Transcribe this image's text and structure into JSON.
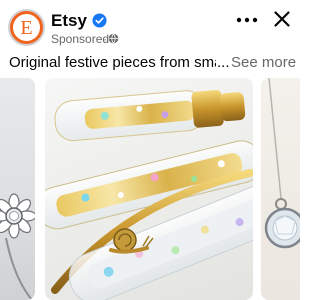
{
  "post": {
    "page_name": "Etsy",
    "avatar_letter": "E",
    "sponsored_label": "Sponsored",
    "dot_separator": "·",
    "caption": "Original festive pieces from small s",
    "ellipsis": "...",
    "see_more": "See more"
  },
  "icons": {
    "verified": "verified-badge-icon",
    "globe": "globe-icon",
    "more": "more-options-icon",
    "close": "close-icon"
  },
  "colors": {
    "brand": "#f1641e",
    "verified": "#1877f2",
    "secondary_text": "#65676b",
    "primary_text": "#050505"
  },
  "carousel": {
    "cards": [
      {
        "subject": "silver flower ring"
      },
      {
        "subject": "gold glitter pens with snail"
      },
      {
        "subject": "crystal pendant"
      }
    ]
  }
}
